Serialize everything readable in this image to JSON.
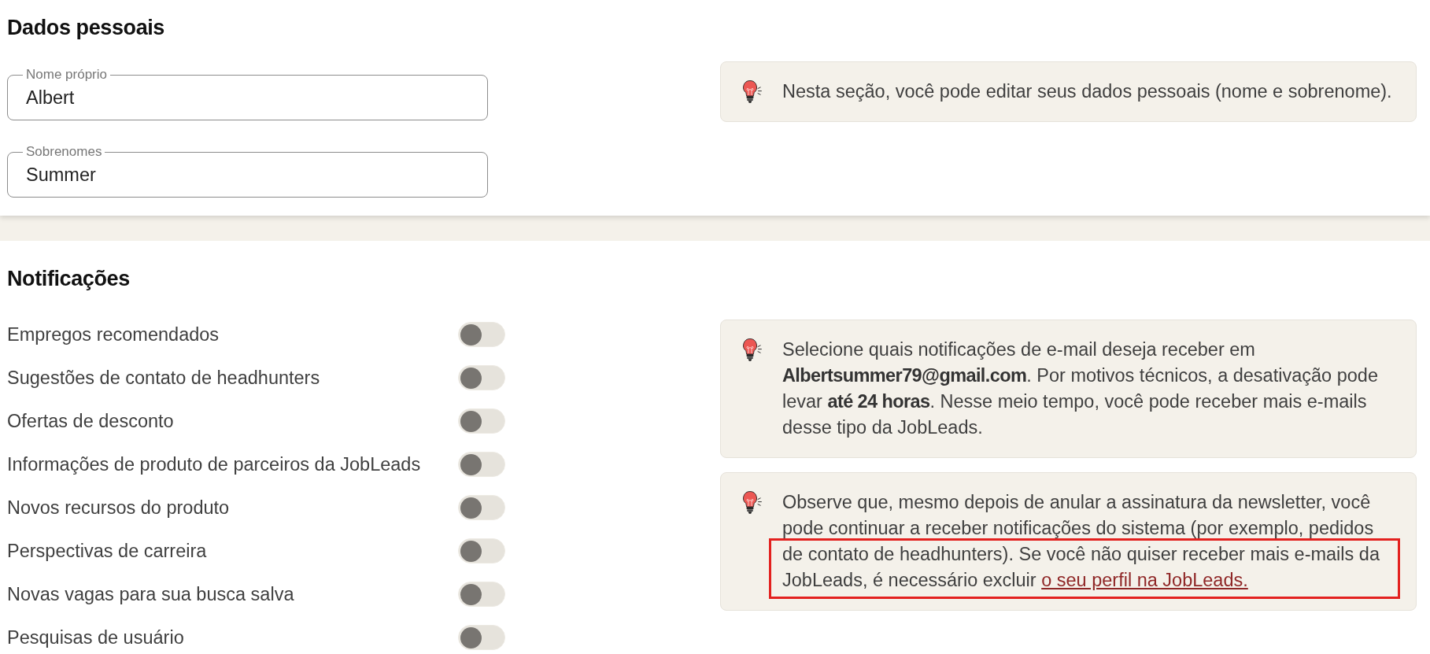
{
  "personal_data": {
    "title": "Dados pessoais",
    "fields": [
      {
        "label": "Nome próprio",
        "value": "Albert"
      },
      {
        "label": "Sobrenomes",
        "value": "Summer"
      }
    ],
    "tip": {
      "text": "Nesta seção, você pode editar seus dados pessoais (nome e sobrenome)."
    }
  },
  "notifications": {
    "title": "Notificações",
    "items": [
      {
        "label": "Empregos recomendados",
        "on": false
      },
      {
        "label": "Sugestões de contato de headhunters",
        "on": false
      },
      {
        "label": "Ofertas de desconto",
        "on": false
      },
      {
        "label": "Informações de produto de parceiros da JobLeads",
        "on": false
      },
      {
        "label": "Novos recursos do produto",
        "on": false
      },
      {
        "label": "Perspectivas de carreira",
        "on": false
      },
      {
        "label": "Novas vagas para sua busca salva",
        "on": false
      },
      {
        "label": "Pesquisas de usuário",
        "on": false
      }
    ],
    "tips": [
      {
        "text": "Selecione quais notificações de e-mail deseja receber em **Albertsummer79@gmail.com**. Por motivos técnicos, a desativação pode levar **até 24 horas**. Nesse meio tempo, você pode receber mais e-mails desse tipo da JobLeads.",
        "highlighted": false
      },
      {
        "text": "Observe que, mesmo depois de anular a assinatura da newsletter, você pode continuar a receber notificações do sistema (por exemplo, pedidos de contato de headhunters). Se você não quiser receber mais e-mails da JobLeads, é necessário excluir",
        "link": "o seu perfil na JobLeads.",
        "highlighted": true
      }
    ]
  }
}
